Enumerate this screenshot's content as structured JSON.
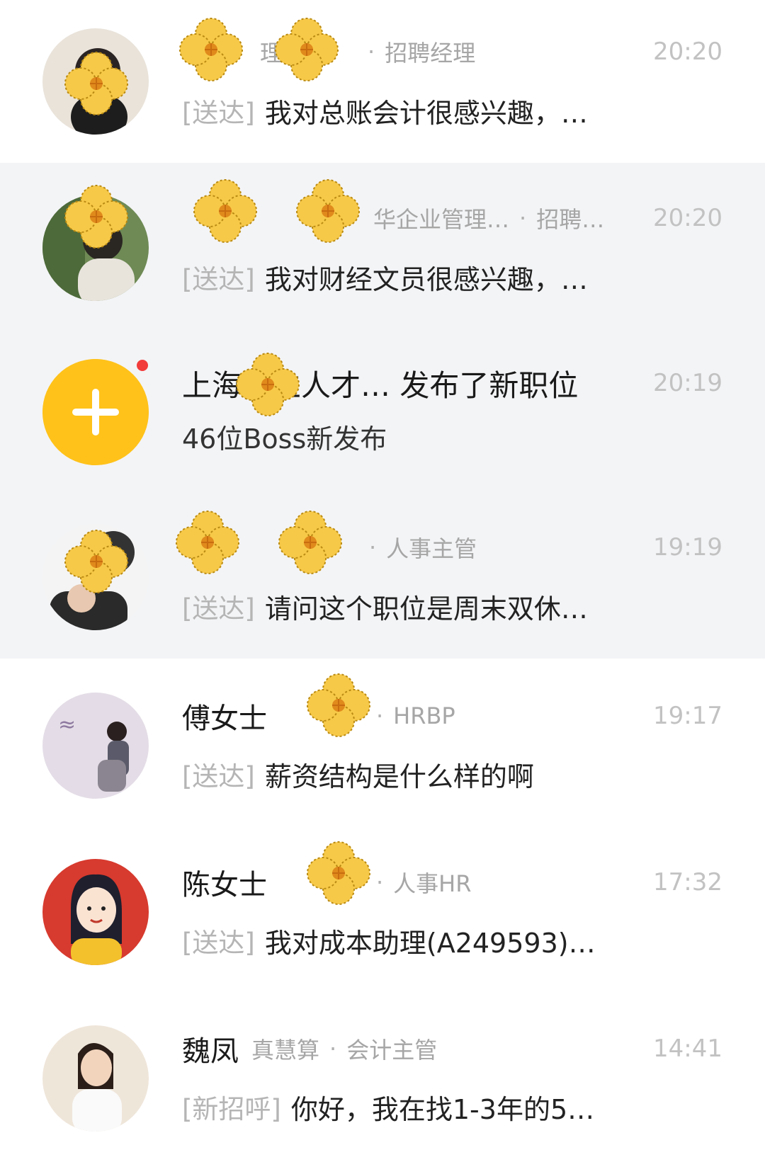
{
  "chats": [
    {
      "name": "",
      "company": "理",
      "role": "招聘经理",
      "time": "20:20",
      "status": "[送达]",
      "message": "我对总账会计很感兴趣，…"
    },
    {
      "name": "",
      "company": "华企业管理…",
      "role": "招聘…",
      "time": "20:20",
      "status": "[送达]",
      "message": "我对财经文员很感兴趣，…"
    },
    {
      "notice_title": "上海…立人才… 发布了新职位",
      "notice_sub": "46位Boss新发布",
      "time": "20:19"
    },
    {
      "name": "",
      "company": "",
      "role": "人事主管",
      "time": "19:19",
      "status": "[送达]",
      "message": "请问这个职位是周末双休…"
    },
    {
      "name": "傅女士",
      "company": "",
      "role": "HRBP",
      "time": "19:17",
      "status": "[送达]",
      "message": "薪资结构是什么样的啊"
    },
    {
      "name": "陈女士",
      "company": "",
      "role": "人事HR",
      "time": "17:32",
      "status": "[送达]",
      "message": "我对成本助理(A249593)…"
    },
    {
      "name": "魏凤",
      "company": "真慧算",
      "role": "会计主管",
      "time": "14:41",
      "status": "[新招呼]",
      "message": "你好，我在找1-3年的5…"
    }
  ],
  "separator": "·",
  "colors": {
    "notice_avatar": "#ffc21a",
    "red_dot": "#f23b3b",
    "flower": "#f7c948",
    "row_shade": "#f3f4f6"
  }
}
